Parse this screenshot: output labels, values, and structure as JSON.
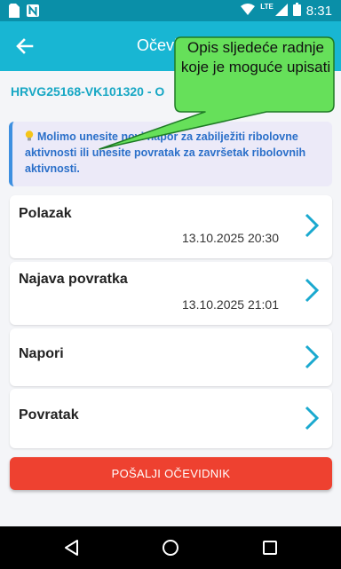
{
  "status_bar": {
    "time": "8:31",
    "network": "LTE",
    "icons": [
      "sim-icon",
      "n-notification-icon",
      "wifi-icon",
      "signal-icon",
      "battery-icon"
    ]
  },
  "app_bar": {
    "title": "Očevi",
    "back_icon": "arrow-left-icon"
  },
  "subtitle": "HRVG25168-VK101320 - O",
  "info": {
    "icon": "lightbulb-icon",
    "text": "Molimo unesite novi napor za zabilježiti ribolovne aktivnosti ili unesite povratak za završetak ribolovnih aktivnosti."
  },
  "cards": [
    {
      "title": "Polazak",
      "date": "13.10.2025 20:30"
    },
    {
      "title": "Najava povratka",
      "date": "13.10.2025 21:01"
    },
    {
      "title": "Napori",
      "date": ""
    },
    {
      "title": "Povratak",
      "date": ""
    }
  ],
  "send_button": "POŠALJI OČEVIDNIK",
  "callout": {
    "text": "Opis sljedeće radnje koje je moguće upisati"
  },
  "nav": {
    "back": "triangle-back-icon",
    "home": "circle-home-icon",
    "recents": "square-recents-icon"
  },
  "colors": {
    "accent": "#18b6d3",
    "status_bar": "#0a8fa8",
    "send_button": "#ee4130",
    "info_text": "#2a6fc9",
    "callout_fill": "#66e05a",
    "chevron": "#1aa9cf"
  }
}
